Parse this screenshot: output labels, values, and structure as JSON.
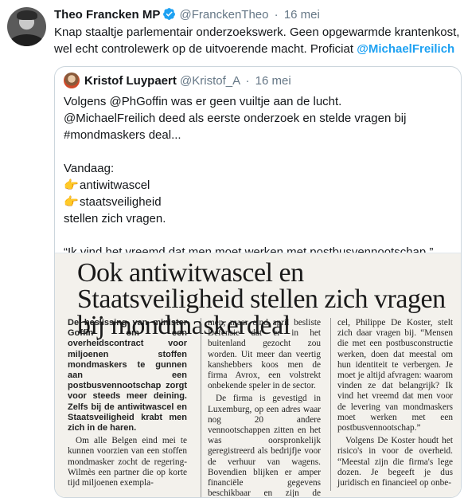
{
  "tweet": {
    "name": "Theo Francken MP",
    "handle": "@FranckenTheo",
    "separator": "·",
    "time": "16 mei",
    "text_main": "Knap staaltje parlementair onderzoekswerk. Geen opgewarmde krantenkost, wel echt controlewerk op de uitvoerende macht. Proficiat ",
    "text_mention": "@MichaelFreilich"
  },
  "quote": {
    "name": "Kristof Luypaert",
    "handle": "@Kristof_A",
    "separator": "·",
    "time": "16 mei",
    "line1": "Volgens @PhGoffin was er geen vuiltje aan de lucht.",
    "line2": "@MichaelFreilich deed als eerste onderzoek en stelde vragen bij",
    "line3": "#mondmaskers deal...",
    "line4": "Vandaag:",
    "bullet1": "antiwitwascel",
    "bullet2": "staatsveiligheid",
    "line5": "stellen zich vragen.",
    "line6": "“Ik vind het vreemd dat men moet werken met postbusvennootschap.”",
    "hand_glyph": "👉"
  },
  "article": {
    "title": "Ook antiwitwascel en Staatsveiligheid stellen zich vragen bij mondmaskerdeal",
    "col1_lead": "De beslissing van minister Goffin om een overheidscontract voor miljoenen stoffen mondmaskers te gunnen aan een postbusvennootschap zorgt voor steeds meer deining. Zelfs bij de antiwitwascel en Staatsveiligheid krabt men zich in de haren.",
    "col1_body": "Om alle Belgen eind mei te kunnen voorzien van een stoffen mondmasker zocht de regering-Wilmès een partner die op korte tijd miljoenen exempla-",
    "col2_p1": "men, maar eind april besliste Defensie dat er in het buitenland gezocht zou worden. Uit meer dan veertig kanshebbers koos men de firma Avrox, een volstrekt onbekende speler in de sector.",
    "col2_p2": "De firma is gevestigd in Luxemburg, op een adres waar nog 20 andere vennootschappen zitten en het was oorspronkelijk geregistreerd als bedrijfje voor de verhuur van wagens. Bovendien blijken er amper financiële gegevens beschikbaar en zijn de zaakvoerders een",
    "col3_p1": "cel, Philippe De Koster, stelt zich daar vragen bij. “Mensen die met een postbusconstructie werken, doen dat meestal om hun identiteit te verbergen. Je moet je altijd afvragen: waarom vinden ze dat belangrijk? Ik vind het vreemd dat men voor de levering van mondmaskers moet werken met een postbusvennootschap.”",
    "col3_p2": "Volgens De Koster houdt het risico's in voor de overheid. “Meestal zijn die firma's lege dozen. Je begeeft je dus juridisch en financieel op onbe-"
  },
  "colors": {
    "link": "#1da1f2",
    "muted": "#657786",
    "border": "#ccd6dd",
    "verified": "#1da1f2"
  }
}
